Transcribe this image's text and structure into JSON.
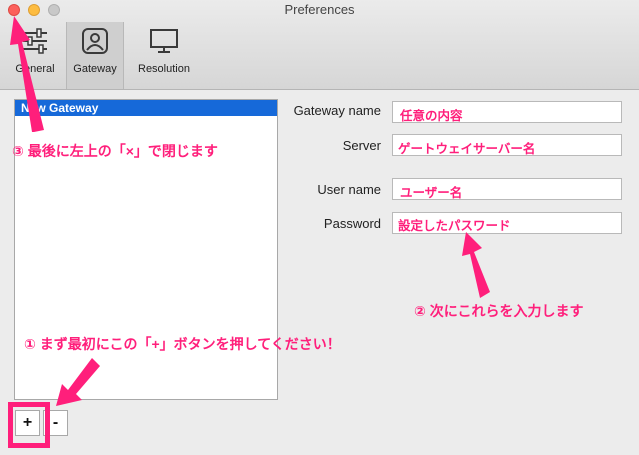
{
  "window": {
    "title": "Preferences"
  },
  "tabs": [
    {
      "label": "General",
      "icon": "sliders-icon"
    },
    {
      "label": "Gateway",
      "icon": "gateway-icon",
      "selected": true
    },
    {
      "label": "Resolution",
      "icon": "monitor-icon"
    }
  ],
  "gateway_list": {
    "items": [
      "New Gateway"
    ],
    "selected": 0
  },
  "buttons": {
    "add": "+",
    "remove": "-"
  },
  "form": {
    "gateway_name": {
      "label": "Gateway name",
      "value": "",
      "hint": "任意の内容"
    },
    "server": {
      "label": "Server",
      "value": "",
      "hint": "ゲートウェイサーバー名"
    },
    "user_name": {
      "label": "User name",
      "value": "",
      "hint": "ユーザー名"
    },
    "password": {
      "label": "Password",
      "value": "",
      "hint": "設定したパスワード"
    }
  },
  "annotations": {
    "step1": "① まず最初にこの「+」ボタンを押してください！",
    "step2": "② 次にこれらを入力します",
    "step3": "③ 最後に左上の「×」で閉じます"
  },
  "colors": {
    "annotation": "#ff1f7b",
    "selection": "#1669d9"
  }
}
